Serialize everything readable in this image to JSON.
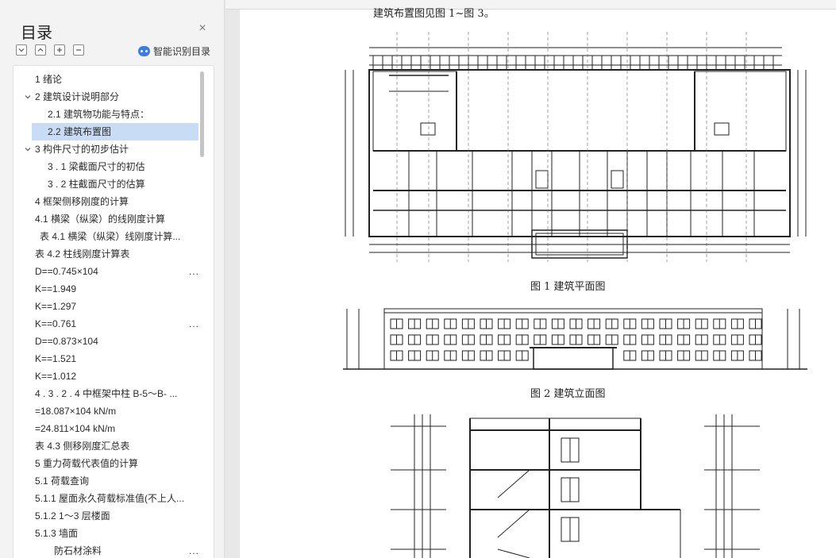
{
  "sidebar": {
    "title": "目录",
    "smart_toc_label": "智能识别目录",
    "items": [
      {
        "text": "1   绪论",
        "level": 1,
        "caret": "none",
        "more": false
      },
      {
        "text": "2   建筑设计说明部分",
        "level": 1,
        "caret": "down",
        "more": false
      },
      {
        "text": "2.1    建筑物功能与特点：",
        "level": 2,
        "caret": "none",
        "more": false
      },
      {
        "text": "2.2    建筑布置图",
        "level": 2,
        "caret": "none",
        "more": false,
        "selected": true
      },
      {
        "text": "3   构件尺寸的初步估计",
        "level": 1,
        "caret": "down",
        "more": false
      },
      {
        "text": "3 . 1    梁截面尺寸的初估",
        "level": 2,
        "caret": "none",
        "more": false
      },
      {
        "text": "3 . 2    柱截面尺寸的估算",
        "level": 2,
        "caret": "none",
        "more": false
      },
      {
        "text": "4   框架侧移刚度的计算",
        "level": 0,
        "caret": "none",
        "more": false
      },
      {
        "text": "4.1    横梁（纵梁）的线刚度计算",
        "level": 0,
        "caret": "none",
        "more": false
      },
      {
        "text": "表 4.1  横梁（纵梁）线刚度计算...",
        "level": 3,
        "caret": "none",
        "more": false
      },
      {
        "text": "表 4.2  柱线刚度计算表",
        "level": 0,
        "caret": "none",
        "more": false
      },
      {
        "text": "D==0.745×104",
        "level": 0,
        "caret": "none",
        "more": true
      },
      {
        "text": "K==1.949",
        "level": 0,
        "caret": "none",
        "more": false
      },
      {
        "text": "K==1.297",
        "level": 0,
        "caret": "none",
        "more": false
      },
      {
        "text": "K==0.761",
        "level": 0,
        "caret": "none",
        "more": true
      },
      {
        "text": "D==0.873×104",
        "level": 0,
        "caret": "none",
        "more": false
      },
      {
        "text": "K==1.521",
        "level": 0,
        "caret": "none",
        "more": false
      },
      {
        "text": "K==1.012",
        "level": 0,
        "caret": "none",
        "more": false
      },
      {
        "text": "4 . 3 . 2 . 4    中框架中柱 B-5～B- ...",
        "level": 0,
        "caret": "none",
        "more": false
      },
      {
        "text": "=18.087×104 kN/m",
        "level": 0,
        "caret": "none",
        "more": false
      },
      {
        "text": "=24.811×104 kN/m",
        "level": 0,
        "caret": "none",
        "more": false
      },
      {
        "text": "表 4.3  侧移刚度汇总表",
        "level": 0,
        "caret": "none",
        "more": false
      },
      {
        "text": "5  重力荷载代表值的计算",
        "level": 0,
        "caret": "none",
        "more": false
      },
      {
        "text": "5.1    荷载查询",
        "level": 0,
        "caret": "none",
        "more": false
      },
      {
        "text": "5.1.1    屋面永久荷载标准值(不上人...",
        "level": 0,
        "caret": "none",
        "more": false
      },
      {
        "text": "5.1.2    1～3 层楼面",
        "level": 0,
        "caret": "none",
        "more": false
      },
      {
        "text": "5.1.3    墙面",
        "level": 0,
        "caret": "none",
        "more": false
      },
      {
        "text": "防石材涂料",
        "level": 4,
        "caret": "none",
        "more": true
      }
    ]
  },
  "document": {
    "top_text": "建筑布置图见图 1~图 3。",
    "fig1_caption": "图 1    建筑平面图",
    "fig2_caption": "图 2    建筑立面图"
  },
  "colors": {
    "selected": "#c9dcf6",
    "accent": "#3b7ddd"
  }
}
